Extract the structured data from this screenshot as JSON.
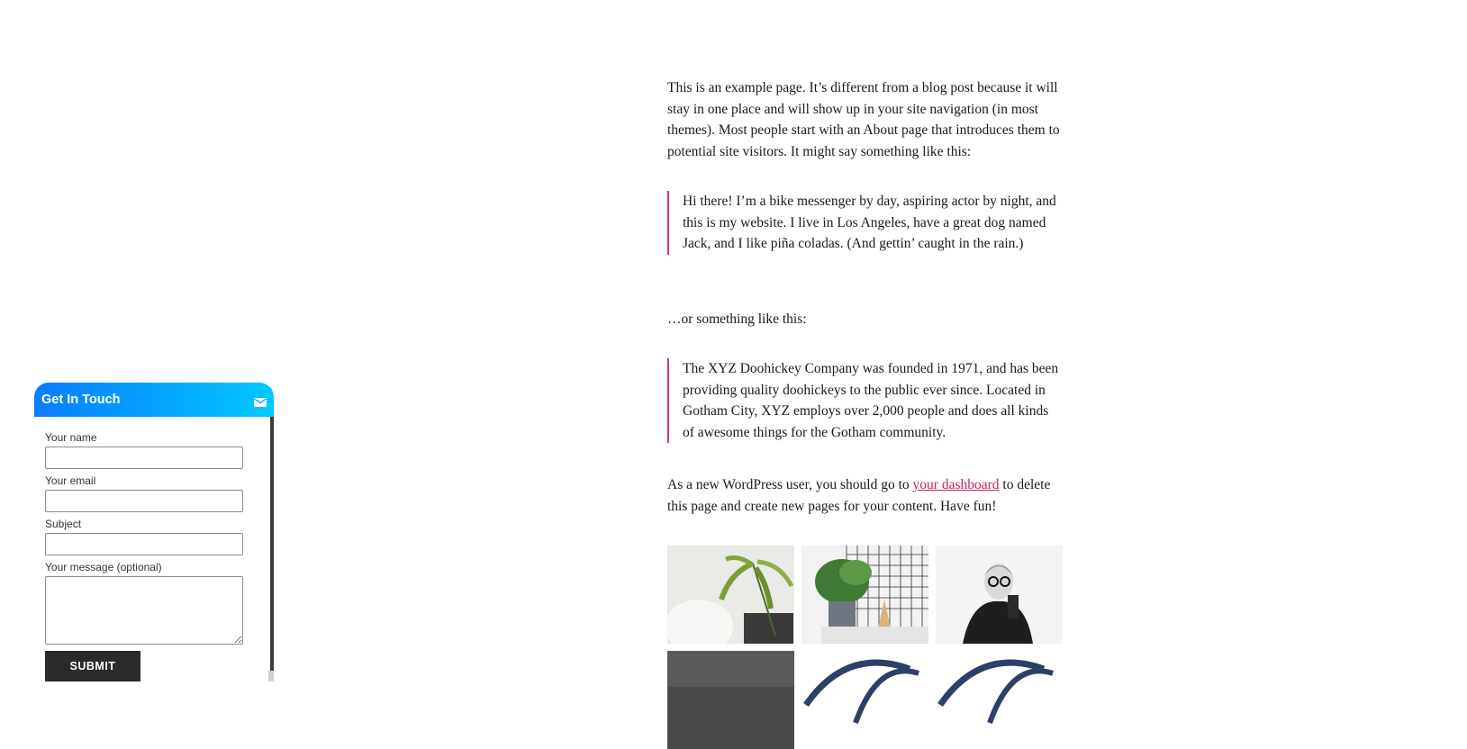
{
  "content": {
    "intro": "This is an example page. It’s different from a blog post because it will stay in one place and will show up in your site navigation (in most themes). Most people start with an About page that introduces them to potential site visitors. It might say something like this:",
    "quote1": "Hi there! I’m a bike messenger by day, aspiring actor by night, and this is my website. I live in Los Angeles, have a great dog named Jack, and I like piña coladas. (And gettin’ caught in the rain.)",
    "or_line": "…or something like this:",
    "quote2": "The XYZ Doohickey Company was founded in 1971, and has been providing quality doohickeys to the public ever since. Located in Gotham City, XYZ employs over 2,000 people and does all kinds of awesome things for the Gotham community.",
    "dashboard_pre": "As a new WordPress user, you should go to ",
    "dashboard_link": "your dashboard",
    "dashboard_post": " to delete this page and create new pages for your content. Have fun!"
  },
  "gallery": {
    "tiles": [
      {
        "icon": "palm-chair-photo"
      },
      {
        "icon": "plant-grid-letter-photo"
      },
      {
        "icon": "woman-glasses-photo"
      },
      {
        "icon": "dark-gray-photo"
      },
      {
        "icon": "script-logo-photo"
      },
      {
        "icon": "script-logo-photo"
      }
    ]
  },
  "widget": {
    "title": "Get In Touch",
    "icon": "mail-icon",
    "accent_start": "#0a7cff",
    "accent_end": "#00c8ff",
    "name_label": "Your name",
    "email_label": "Your email",
    "subject_label": "Subject",
    "message_label": "Your message (optional)",
    "submit_label": "SUBMIT"
  },
  "colors": {
    "link": "#c6255a",
    "quote_border": "#d6336c"
  }
}
